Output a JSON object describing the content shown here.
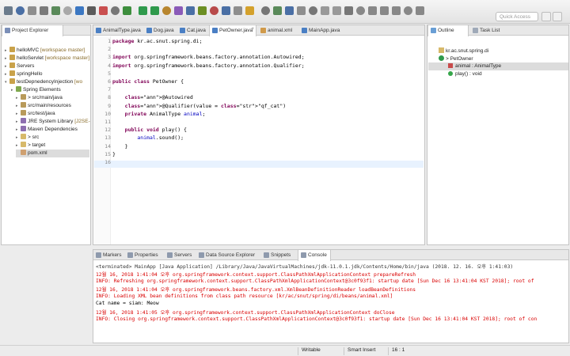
{
  "quick_access_placeholder": "Quick Access",
  "explorer": {
    "tab_label": "Project Explorer",
    "items": [
      {
        "label": "helloMVC",
        "decoration": " [workspace master]"
      },
      {
        "label": "helloServlet",
        "decoration": " [workspace master]"
      },
      {
        "label": "Servers",
        "decoration": ""
      },
      {
        "label": "springHello",
        "decoration": ""
      },
      {
        "label": "testDepnedencyInjection",
        "decoration": " [wo"
      },
      {
        "label": "Spring Elements",
        "decoration": ""
      },
      {
        "label": "> src/main/java",
        "decoration": ""
      },
      {
        "label": "src/main/resources",
        "decoration": ""
      },
      {
        "label": "src/test/java",
        "decoration": ""
      },
      {
        "label": "JRE System Library",
        "decoration": " [J2SE-1"
      },
      {
        "label": "Maven Dependencies",
        "decoration": ""
      },
      {
        "label": "> src",
        "decoration": ""
      },
      {
        "label": "> target",
        "decoration": ""
      },
      {
        "label": "pom.xml",
        "decoration": ""
      }
    ]
  },
  "editor": {
    "tabs": [
      "AnimalType.java",
      "Dog.java",
      "Cat.java",
      "PetOwner.java",
      "animal.xml",
      "MainApp.java"
    ],
    "active_tab": "PetOwner.java",
    "line_numbers": [
      "1",
      "2",
      "3",
      "4",
      "5",
      "6",
      "7",
      "8",
      "9",
      "10",
      "11",
      "12",
      "13",
      "14",
      "15",
      "16"
    ],
    "lines": [
      "package kr.ac.snut.spring.di;",
      "",
      "import org.springframework.beans.factory.annotation.Autowired;",
      "import org.springframework.beans.factory.annotation.Qualifier;",
      "",
      "public class PetOwner {",
      "",
      "    @Autowired",
      "    @Qualifier(value = \"qf_cat\")",
      "    private AnimalType animal;",
      "",
      "    public void play() {",
      "        animal.sound();",
      "    }",
      "}",
      ""
    ]
  },
  "outline": {
    "tab_label": "Outline",
    "task_tab_label": "Task List",
    "items": [
      {
        "label": "kr.ac.snut.spring.di"
      },
      {
        "label": "> PetOwner"
      },
      {
        "label": "animal : AnimalType"
      },
      {
        "label": "play() : void"
      }
    ]
  },
  "console": {
    "tabs": [
      "Markers",
      "Properties",
      "Servers",
      "Data Source Explorer",
      "Snippets",
      "Console"
    ],
    "header": "<terminated> MainApp [Java Application] /Library/Java/JavaVirtualMachines/jdk-11.0.1.jdk/Contents/Home/bin/java (2018. 12. 16. 오후 1:41:03)",
    "lines": [
      {
        "text": "12월 16, 2018 1:41:04 오후 org.springframework.context.support.ClassPathXmlApplicationContext prepareRefresh",
        "color": "red"
      },
      {
        "text": "INFO: Refreshing org.springframework.context.support.ClassPathXmlApplicationContext@3c0f93f1: startup date [Sun Dec 16 13:41:04 KST 2018]; root of",
        "color": "red"
      },
      {
        "text": "12월 16, 2018 1:41:04 오후 org.springframework.beans.factory.xml.XmlBeanDefinitionReader loadBeanDefinitions",
        "color": "red"
      },
      {
        "text": "INFO: Loading XML bean definitions from class path resource [kr/ac/snut/spring/di/beans/animal.xml]",
        "color": "red"
      },
      {
        "text": "Cat name = siam: Meow",
        "color": "black"
      },
      {
        "text": "12월 16, 2018 1:41:05 오후 org.springframework.context.support.ClassPathXmlApplicationContext doClose",
        "color": "red"
      },
      {
        "text": "INFO: Closing org.springframework.context.support.ClassPathXmlApplicationContext@3c0f93f1: startup date [Sun Dec 16 13:41:04 KST 2018]; root of con",
        "color": "red"
      }
    ]
  },
  "status": {
    "writable": "Writable",
    "insert_mode": "Smart Insert",
    "position": "16 : 1"
  }
}
